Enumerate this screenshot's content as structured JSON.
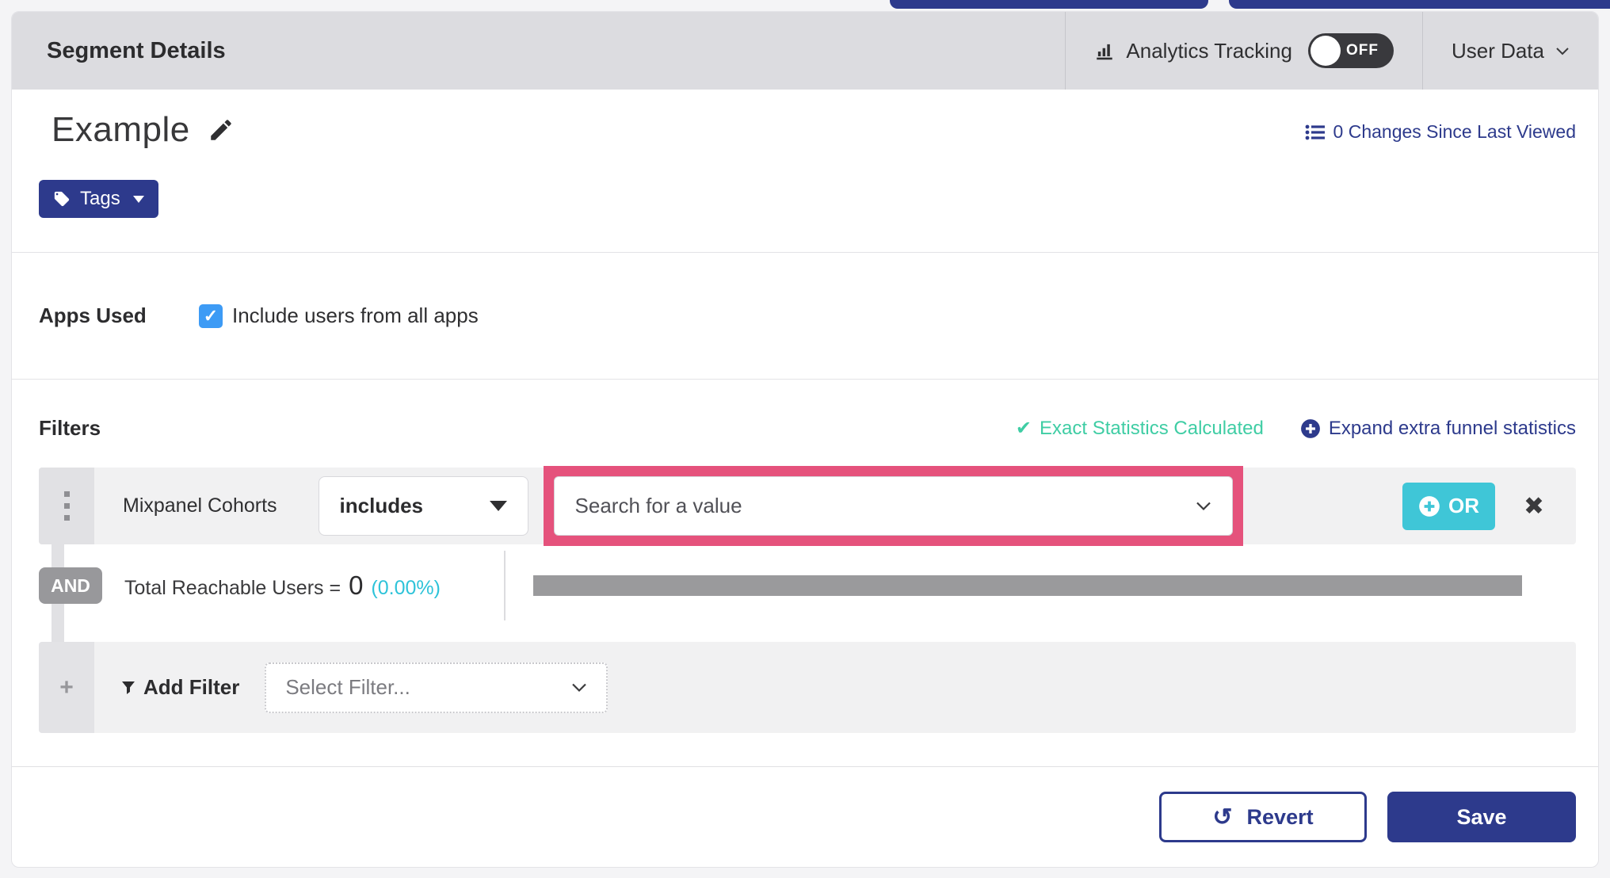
{
  "colors": {
    "primary_indigo": "#2d3a8c",
    "teal_or_button": "#3fc6d7",
    "green_status": "#3fcda4",
    "cyan_percent": "#2ec3d9",
    "pink_highlight": "#e5527c",
    "toggle_dark": "#39393d",
    "checkbox_blue": "#3d9bf5",
    "header_gray": "#dcdce0",
    "row_gray": "#f1f1f2",
    "progress_bar_gray": "#9a9a9c"
  },
  "header": {
    "title": "Segment Details",
    "analytics_tracking": {
      "label": "Analytics Tracking",
      "toggle_state": "OFF"
    },
    "user_data_label": "User Data"
  },
  "segment": {
    "name": "Example",
    "changes_link": "0 Changes Since Last Viewed",
    "tags_button_label": "Tags"
  },
  "apps_used": {
    "label": "Apps Used",
    "checkbox_label": "Include users from all apps",
    "checkbox_checked": true,
    "check_glyph": "✓"
  },
  "filters": {
    "heading": "Filters",
    "exact_status": "Exact Statistics Calculated",
    "exact_check_glyph": "✔",
    "expand_link": "Expand extra funnel statistics",
    "row": {
      "field": "Mixpanel Cohorts",
      "operator": "includes",
      "value_placeholder": "Search for a value",
      "or_button_label": "OR",
      "remove_glyph": "✖"
    },
    "and_badge": "AND",
    "total_reachable": {
      "label": "Total Reachable Users =",
      "value": "0",
      "percent": "(0.00%)"
    },
    "add_filter": {
      "plus_glyph": "+",
      "label": "Add Filter",
      "select_placeholder": "Select Filter..."
    }
  },
  "footer": {
    "revert_label": "Revert",
    "revert_icon_glyph": "↺",
    "save_label": "Save"
  },
  "icons": {
    "analytics": "bar-chart-icon",
    "user_data_caret": "chevron-down-icon",
    "edit": "pencil-icon",
    "changes": "list-icon",
    "tag": "tag-icon",
    "tags_caret": "caret-down-icon",
    "expand_plus": "plus-circle-icon",
    "drag_handle": "grip-dots-icon",
    "operator_caret": "caret-down-icon",
    "value_caret": "chevron-down-icon",
    "or_plus": "plus-circle-icon",
    "funnel": "funnel-icon",
    "revert": "rotate-ccw-icon"
  }
}
